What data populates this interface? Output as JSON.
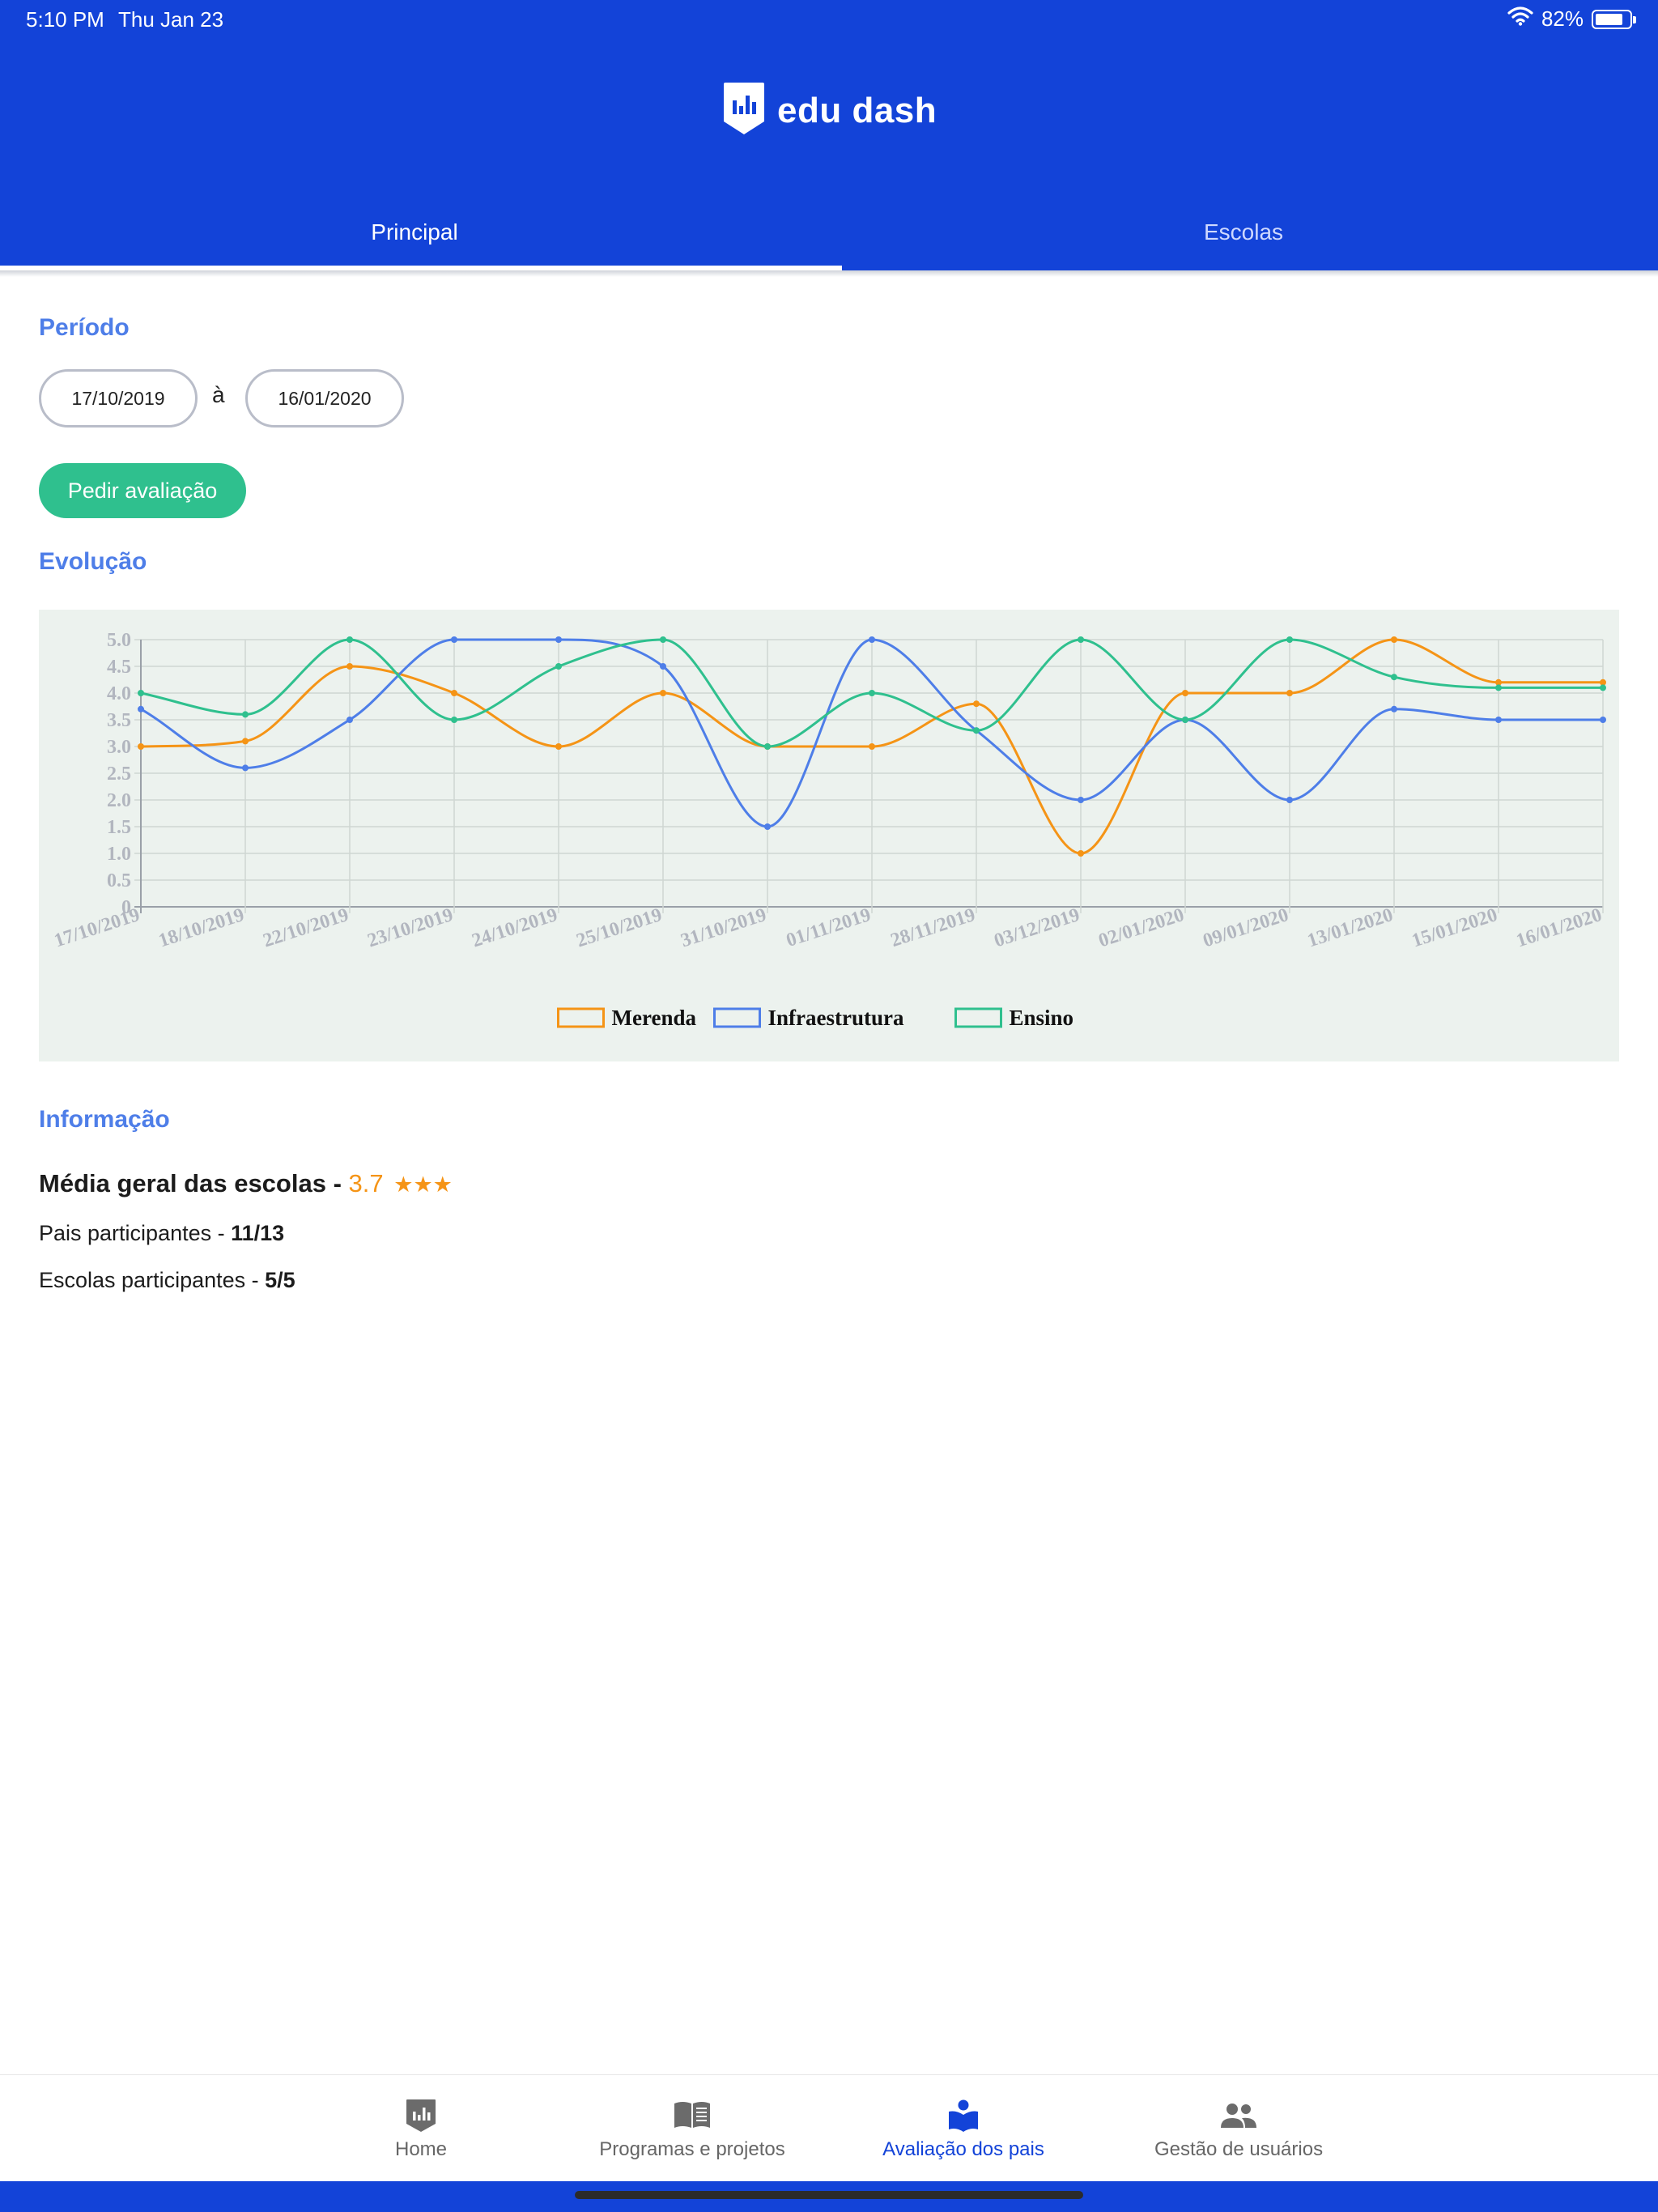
{
  "status_bar": {
    "time": "5:10 PM",
    "date": "Thu Jan 23",
    "battery": "82%",
    "battery_level": 0.82
  },
  "header": {
    "logo_text": "edu dash",
    "logo_icon": "bar-chart-shield-icon"
  },
  "tabs": [
    {
      "label": "Principal",
      "active": true
    },
    {
      "label": "Escolas",
      "active": false
    }
  ],
  "period": {
    "title": "Período",
    "start_date": "17/10/2019",
    "separator": "à",
    "end_date": "16/01/2020"
  },
  "actions": {
    "request_button": "Pedir avaliação"
  },
  "evolution": {
    "title": "Evolução"
  },
  "chart_data": {
    "type": "line",
    "title": "",
    "xlabel": "",
    "ylabel": "",
    "ylim": [
      0,
      5
    ],
    "y_ticks": [
      "0",
      "0.5",
      "1.0",
      "1.5",
      "2.0",
      "2.5",
      "3.0",
      "3.5",
      "4.0",
      "4.5",
      "5.0"
    ],
    "grid": true,
    "legend_position": "bottom",
    "categories": [
      "17/10/2019",
      "18/10/2019",
      "22/10/2019",
      "23/10/2019",
      "24/10/2019",
      "25/10/2019",
      "31/10/2019",
      "01/11/2019",
      "28/11/2019",
      "03/12/2019",
      "02/01/2020",
      "09/01/2020",
      "13/01/2020",
      "15/01/2020",
      "16/01/2020"
    ],
    "series": [
      {
        "name": "Merenda",
        "color": "#f59416",
        "values": [
          3.0,
          3.1,
          4.5,
          4.0,
          3.0,
          4.0,
          3.0,
          3.0,
          3.8,
          1.0,
          4.0,
          4.0,
          5.0,
          4.2,
          4.2
        ]
      },
      {
        "name": "Infraestrutura",
        "color": "#4e7ee8",
        "values": [
          3.7,
          2.6,
          3.5,
          5.0,
          5.0,
          4.5,
          1.5,
          5.0,
          3.3,
          2.0,
          3.5,
          2.0,
          3.7,
          3.5,
          3.5
        ]
      },
      {
        "name": "Ensino",
        "color": "#2fc08e",
        "values": [
          4.0,
          3.6,
          5.0,
          3.5,
          4.5,
          5.0,
          3.0,
          4.0,
          3.3,
          5.0,
          3.5,
          5.0,
          4.3,
          4.1,
          4.1
        ]
      }
    ]
  },
  "info": {
    "title": "Informação",
    "avg_label": "Média geral das escolas -",
    "avg_value": "3.7",
    "avg_stars": "★★★",
    "parents_label": "Pais participantes -",
    "parents_value": "11/13",
    "schools_label": "Escolas participantes -",
    "schools_value": "5/5"
  },
  "bottom_nav": [
    {
      "label": "Home",
      "icon": "home-chart-icon",
      "active": false
    },
    {
      "label": "Programas e projetos",
      "icon": "book-icon",
      "active": false
    },
    {
      "label": "Avaliação dos pais",
      "icon": "reader-icon",
      "active": true
    },
    {
      "label": "Gestão de usuários",
      "icon": "users-icon",
      "active": false
    }
  ],
  "colors": {
    "brand": "#1343d8",
    "accent_blue": "#4e7ee8",
    "accent_green": "#2fc08e",
    "accent_orange": "#f59416"
  }
}
